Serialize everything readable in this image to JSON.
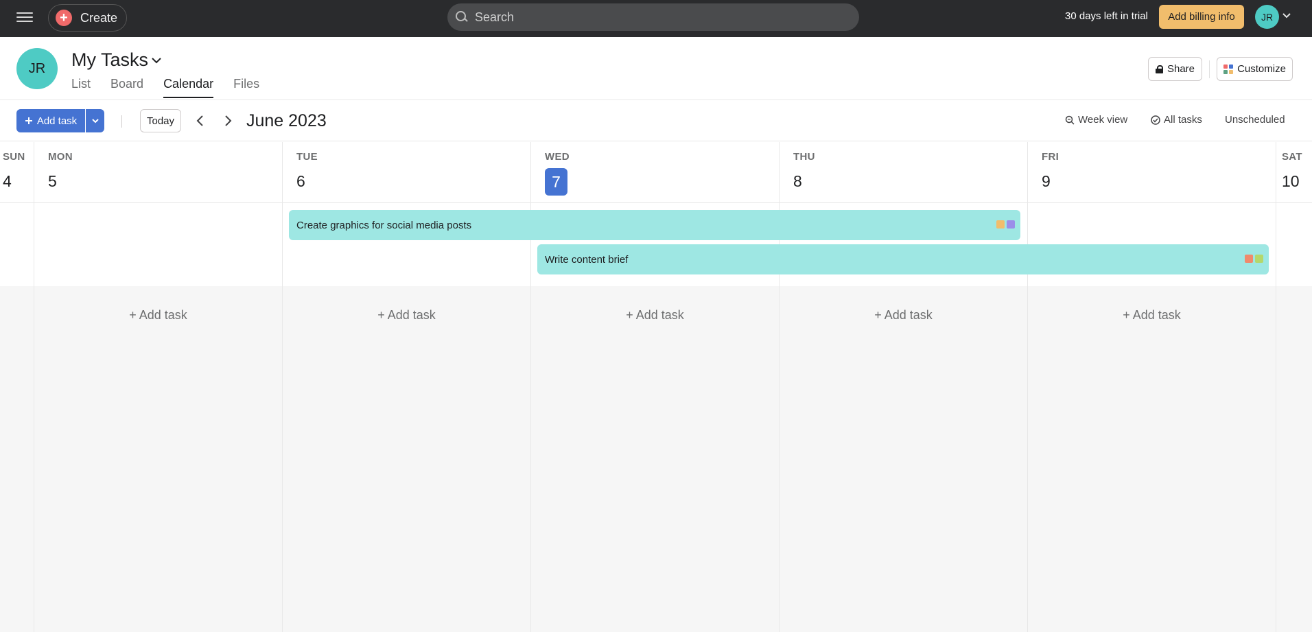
{
  "topbar": {
    "create_label": "Create",
    "search_placeholder": "Search",
    "trial_text": "30 days left in trial",
    "billing_label": "Add billing info",
    "avatar_initials": "JR"
  },
  "header": {
    "avatar_initials": "JR",
    "title": "My Tasks",
    "tabs": [
      {
        "label": "List",
        "active": false
      },
      {
        "label": "Board",
        "active": false
      },
      {
        "label": "Calendar",
        "active": true
      },
      {
        "label": "Files",
        "active": false
      }
    ],
    "share_label": "Share",
    "customize_label": "Customize"
  },
  "toolbar": {
    "add_task_label": "Add task",
    "today_label": "Today",
    "month_label": "June 2023",
    "week_view_label": "Week view",
    "all_tasks_label": "All tasks",
    "unscheduled_label": "Unscheduled"
  },
  "calendar": {
    "days": [
      {
        "dow": "SUN",
        "num": "4"
      },
      {
        "dow": "MON",
        "num": "5"
      },
      {
        "dow": "TUE",
        "num": "6"
      },
      {
        "dow": "WED",
        "num": "7",
        "today": true
      },
      {
        "dow": "THU",
        "num": "8"
      },
      {
        "dow": "FRI",
        "num": "9"
      },
      {
        "dow": "SAT",
        "num": "10"
      }
    ],
    "add_task_cell_label": "+ Add task",
    "tasks": [
      {
        "title": "Create graphics for social media posts",
        "start": "TUE",
        "end": "THU",
        "tag_colors": [
          "#f1bd6c",
          "#9b8ee9"
        ]
      },
      {
        "title": "Write content brief",
        "start": "WED",
        "end": "FRI",
        "tag_colors": [
          "#f08a6c",
          "#b4d86c"
        ]
      }
    ]
  },
  "colors": {
    "topbar_bg": "#2a2b2d",
    "accent_blue": "#4573d2",
    "billing_orange": "#f1bd6c",
    "avatar_teal": "#4ecbc4",
    "task_bar_teal": "#9ee7e3"
  }
}
